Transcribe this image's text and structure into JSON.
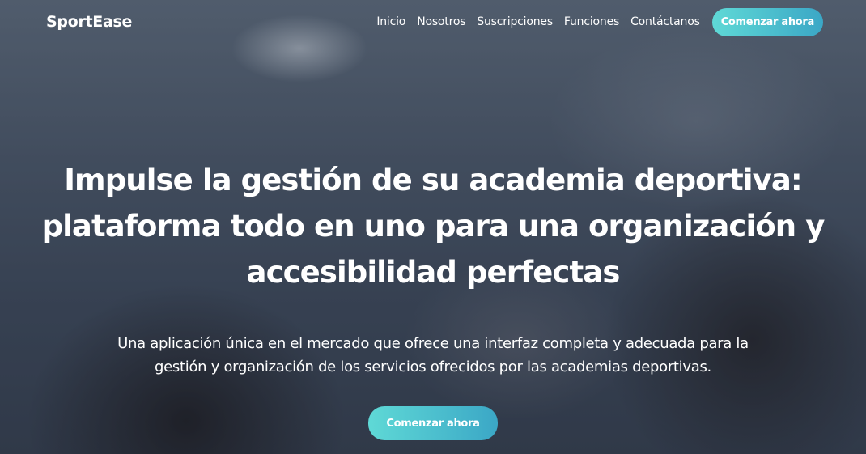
{
  "navbar": {
    "brand": "SportEase",
    "links": [
      "Inicio",
      "Nosotros",
      "Suscripciones",
      "Funciones",
      "Contáctanos"
    ],
    "cta_label": "Comenzar ahora"
  },
  "hero": {
    "headline_line1": "Impulse la gestión de su academia deportiva:",
    "headline_line2": "plataforma todo en uno para una organización y",
    "headline_line3": "accesibilidad perfectas",
    "subtitle_line1": "Una aplicación única en el mercado que ofrece una interfaz completa y adecuada para la",
    "subtitle_line2": "gestión y organización de los servicios ofrecidos por las academias deportivas.",
    "cta_label": "Comenzar ahora"
  },
  "colors": {
    "button_gradient_start": "#5fd9d6",
    "button_gradient_end": "#3ba7c6",
    "text": "#ffffff"
  }
}
